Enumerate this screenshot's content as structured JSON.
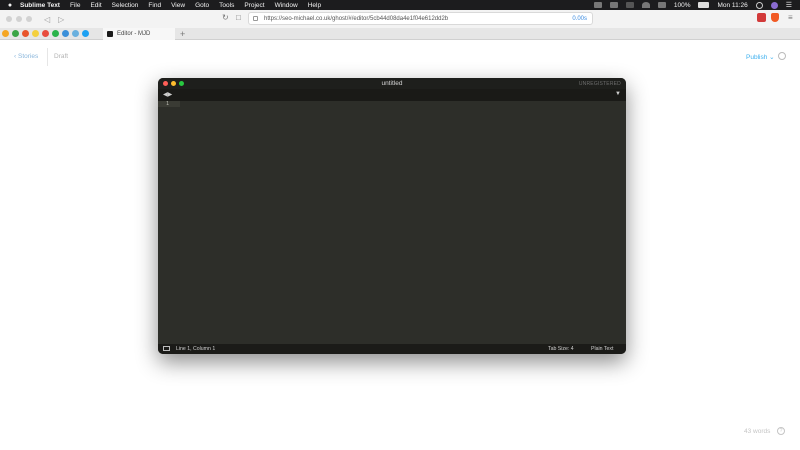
{
  "menubar": {
    "items": [
      "Sublime Text",
      "File",
      "Edit",
      "Selection",
      "Find",
      "View",
      "Goto",
      "Tools",
      "Project",
      "Window",
      "Help"
    ],
    "battery": "100%",
    "clock": "Mon 11:26"
  },
  "browser": {
    "url": "https://seo-michael.co.uk/ghost/#/editor/5cb44d08da4e1f04e612dd2b",
    "zoom": "0.00s",
    "active_tab": "Editor - MJD",
    "new_tab": "+"
  },
  "ghost": {
    "back_label": "Stories",
    "status_label": "Draft",
    "publish_label": "Publish",
    "word_count": "43 words",
    "help_label": "?"
  },
  "sublime": {
    "filename": "untitled",
    "registration": "UNREGISTERED",
    "line_number": "1",
    "cursor_position": "Line 1, Column 1",
    "tab_size": "Tab Size: 4",
    "syntax": "Plain Text"
  },
  "colors": {
    "editor_bg": "#2d2e29",
    "ghost_accent": "#3eb0ef"
  }
}
